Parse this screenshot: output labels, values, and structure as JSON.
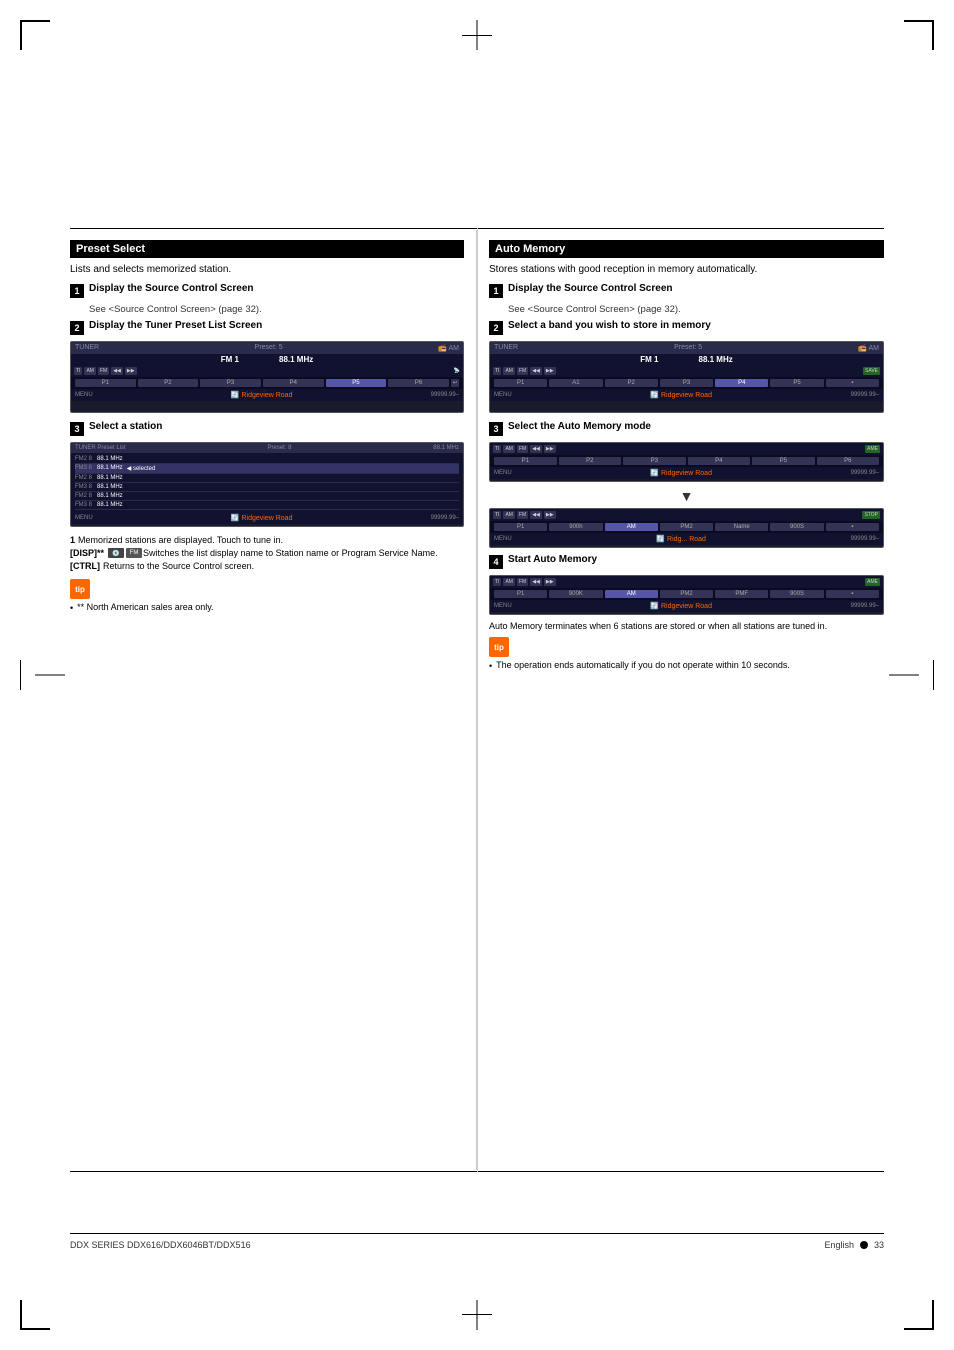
{
  "page": {
    "title": "DDX SERIES DDX616/DDX6046BT/DDX516",
    "page_number": "33",
    "language": "English"
  },
  "left_section": {
    "title": "Preset Select",
    "description": "Lists and selects memorized station.",
    "steps": [
      {
        "num": "1",
        "text": "Display the Source Control Screen",
        "sub": "See <Source Control Screen> (page 32)."
      },
      {
        "num": "2",
        "text": "Display the Tuner Preset List Screen"
      },
      {
        "num": "3",
        "text": "Select a station"
      }
    ],
    "notes": [
      {
        "key": "1",
        "text": "Memorized stations are displayed. Touch to tune in."
      },
      {
        "key": "[DISP]**",
        "icon1": "disc-icon",
        "icon2": "FM-icon",
        "text": "Switches the list display name to Station name or Program Service Name."
      },
      {
        "key": "[CTRL]",
        "text": "Returns to the Source Control screen."
      }
    ],
    "tip_label": "tip",
    "bullets": [
      "** North American sales area only."
    ]
  },
  "right_section": {
    "title": "Auto Memory",
    "description": "Stores stations with good reception in memory automatically.",
    "steps": [
      {
        "num": "1",
        "text": "Display the Source Control Screen",
        "sub": "See <Source Control Screen> (page 32)."
      },
      {
        "num": "2",
        "text": "Select a band you wish to store in memory"
      },
      {
        "num": "3",
        "text": "Select the Auto Memory mode"
      },
      {
        "num": "4",
        "text": "Start Auto Memory"
      }
    ],
    "note_text": "Auto Memory terminates when 6 stations are stored or when all stations are tuned in.",
    "tip_label": "tip",
    "bullets": [
      "The operation ends automatically if you do not operate within 10 seconds."
    ]
  },
  "tuner_screen": {
    "label": "TUNER",
    "preset_label": "Preset: 5",
    "freq_label": "88.1 MHz",
    "band_am": "AM",
    "band_fm": "FM",
    "presets": [
      "P1",
      "P2",
      "P3",
      "P4",
      "P5",
      "P6"
    ],
    "station": "Ridgeview Road",
    "freq_display": "99999.99-"
  },
  "preset_list_screen": {
    "label": "TUNER Preset List",
    "preset_label": "Preset: 8",
    "freq_label": "88.1 MHz",
    "entries": [
      {
        "num": "FM2 8",
        "freq": "88.1 MHz",
        "name": ""
      },
      {
        "num": "FM3 8",
        "freq": "88.1 MHz",
        "name": ""
      },
      {
        "num": "FM2 8",
        "freq": "88.1 MHz",
        "name": ""
      },
      {
        "num": "FM3 8",
        "freq": "88.1 MHz",
        "name": ""
      },
      {
        "num": "FM2 8",
        "freq": "88.1 MHz",
        "name": ""
      },
      {
        "num": "FM3 8",
        "freq": "88.1 MHz",
        "name": ""
      }
    ]
  },
  "icons": {
    "disc": "💿",
    "fm_badge": "FM",
    "tip": "tip",
    "bullet": "•"
  }
}
